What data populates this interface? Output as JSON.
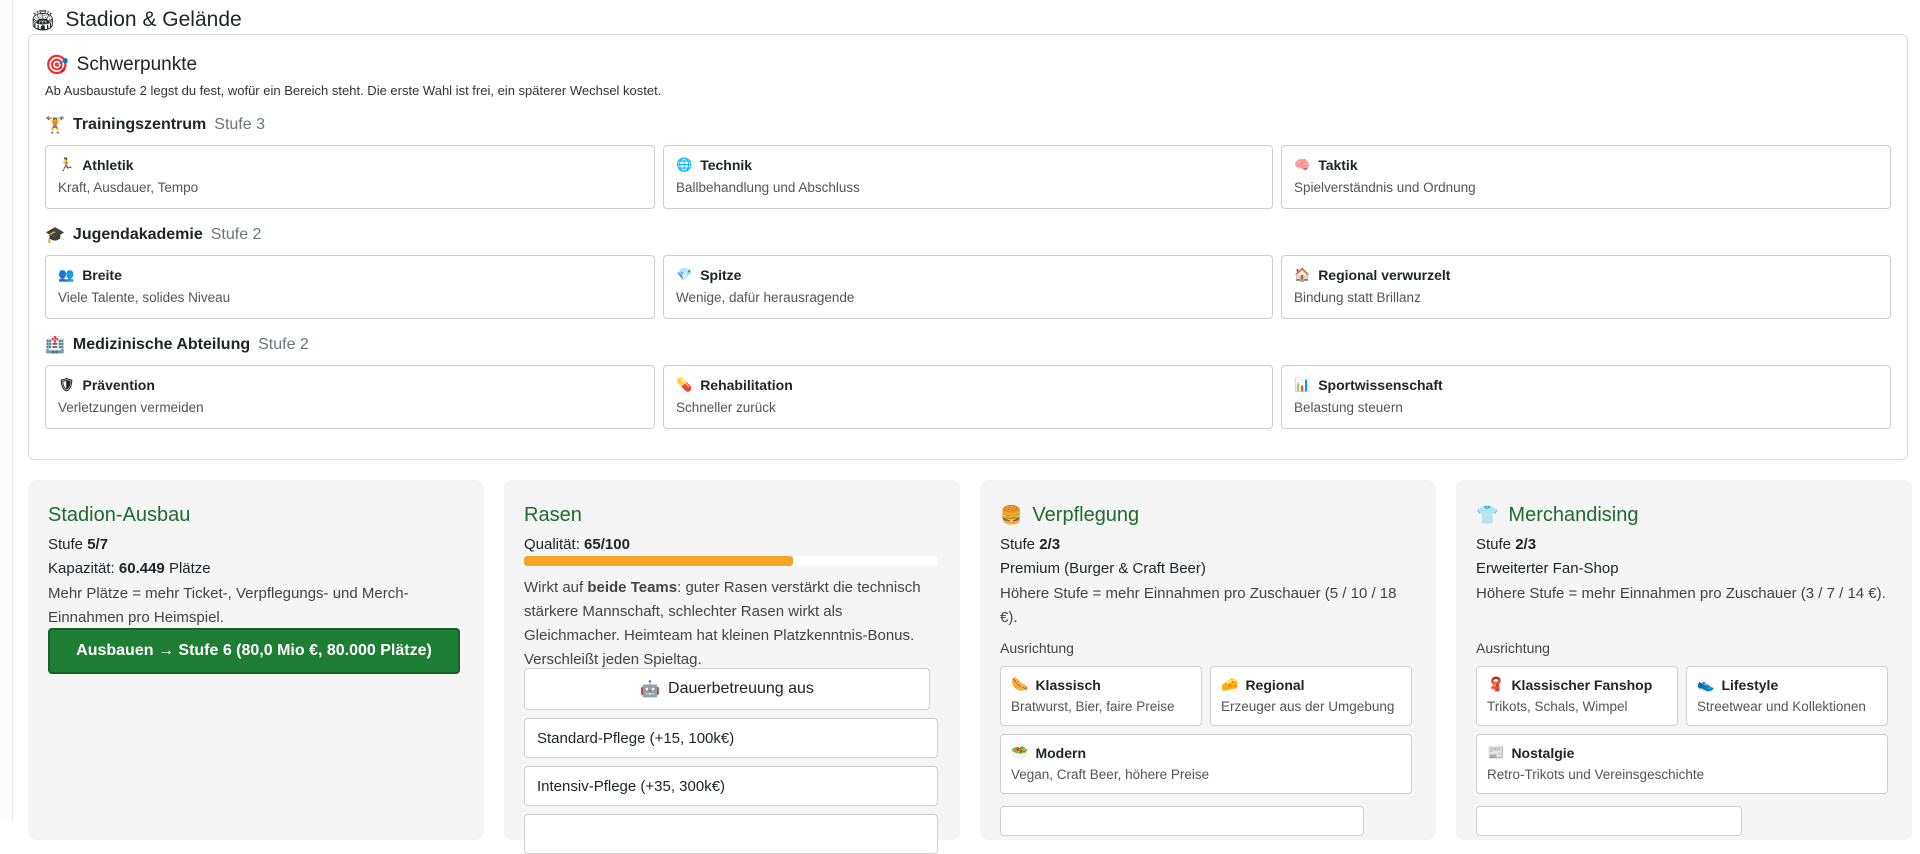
{
  "section": {
    "icon": "stadium-icon",
    "glyph": "🏟",
    "title": "Stadion & Gelände"
  },
  "focus": {
    "icon_glyph": "🎯",
    "title": "Schwerpunkte",
    "description": "Ab Ausbaustufe 2 legst du fest, wofür ein Bereich steht. Die erste Wahl ist frei, ein späterer Wechsel kostet.",
    "groups": [
      {
        "glyph": "🏋",
        "name": "Trainingszentrum",
        "level": "Stufe 3",
        "options": [
          {
            "glyph": "🏃",
            "title": "Athletik",
            "desc": "Kraft, Ausdauer, Tempo"
          },
          {
            "glyph": "🌐",
            "title": "Technik",
            "desc": "Ballbehandlung und Abschluss"
          },
          {
            "glyph": "🧠",
            "title": "Taktik",
            "desc": "Spielverständnis und Ordnung"
          }
        ]
      },
      {
        "glyph": "🎓",
        "name": "Jugendakademie",
        "level": "Stufe 2",
        "options": [
          {
            "glyph": "👥",
            "title": "Breite",
            "desc": "Viele Talente, solides Niveau"
          },
          {
            "glyph": "💎",
            "title": "Spitze",
            "desc": "Wenige, dafür herausragende"
          },
          {
            "glyph": "🏠",
            "title": "Regional verwurzelt",
            "desc": "Bindung statt Brillanz"
          }
        ]
      },
      {
        "glyph": "🏥",
        "name": "Medizinische Abteilung",
        "level": "Stufe 2",
        "options": [
          {
            "glyph": "🛡",
            "title": "Prävention",
            "desc": "Verletzungen vermeiden"
          },
          {
            "glyph": "💊",
            "title": "Rehabilitation",
            "desc": "Schneller zurück"
          },
          {
            "glyph": "📊",
            "title": "Sportwissenschaft",
            "desc": "Belastung steuern"
          }
        ]
      }
    ]
  },
  "stadium": {
    "title": "Stadion-Ausbau",
    "level_label": "Stufe ",
    "level_value": "5/7",
    "capacity_label": "Kapazität: ",
    "capacity_value": "60.449",
    "capacity_unit": " Plätze",
    "description": "Mehr Plätze = mehr Ticket-, Verpflegungs- und Merch-Einnahmen pro Heimspiel.",
    "upgrade_button": "Ausbauen → Stufe 6 (80,0 Mio €, 80.000 Plätze)"
  },
  "pitch": {
    "title": "Rasen",
    "quality_label": "Qualität: ",
    "quality_value": "65/100",
    "quality_fraction": 0.65,
    "desc_1": "Wirkt auf ",
    "desc_bold": "beide Teams",
    "desc_2": ": guter Rasen verstärkt die technisch stärkere Mannschaft, schlechter Rasen wirkt als Gleichmacher. Heimteam hat kleinen Platzkenntnis-Bonus. Verschleißt jeden Spieltag.",
    "care_glyph": "🤖",
    "care_button": "Dauerbetreuung aus",
    "options": [
      "Standard-Pflege (+15, 100k€)",
      "Intensiv-Pflege (+35, 300k€)"
    ]
  },
  "catering": {
    "glyph": "🍔",
    "title": "Verpflegung",
    "level_label": "Stufe ",
    "level_value": "2/3",
    "variant": "Premium (Burger & Craft Beer)",
    "description": "Höhere Stufe = mehr Einnahmen pro Zuschauer (5 / 10 / 18 €).",
    "orientation_label": "Ausrichtung",
    "options": [
      {
        "glyph": "🌭",
        "title": "Klassisch",
        "desc": "Bratwurst, Bier, faire Preise"
      },
      {
        "glyph": "🧀",
        "title": "Regional",
        "desc": "Erzeuger aus der Umgebung"
      },
      {
        "glyph": "🥗",
        "title": "Modern",
        "desc": "Vegan, Craft Beer, höhere Preise"
      }
    ]
  },
  "merch": {
    "glyph": "👕",
    "title": "Merchandising",
    "level_label": "Stufe ",
    "level_value": "2/3",
    "variant": "Erweiterter Fan-Shop",
    "description": "Höhere Stufe = mehr Einnahmen pro Zuschauer (3 / 7 / 14 €).",
    "orientation_label": "Ausrichtung",
    "options": [
      {
        "glyph": "🧣",
        "title": "Klassischer Fanshop",
        "desc": "Trikots, Schals, Wimpel"
      },
      {
        "glyph": "👟",
        "title": "Lifestyle",
        "desc": "Streetwear und Kollektionen"
      },
      {
        "glyph": "📰",
        "title": "Nostalgie",
        "desc": "Retro-Trikots und Vereinsgeschichte"
      }
    ]
  }
}
